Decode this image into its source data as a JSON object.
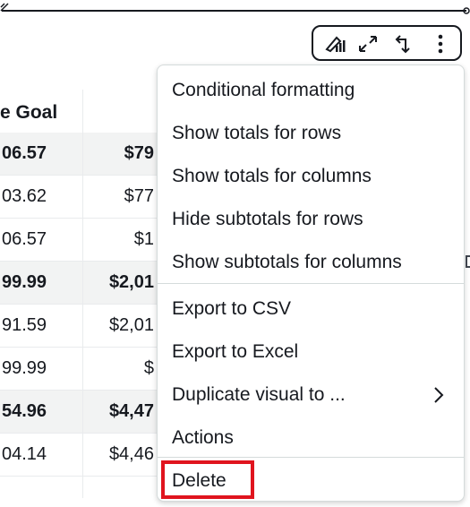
{
  "table": {
    "header_col1": "e Goal",
    "rows": [
      {
        "c1": "06.57",
        "c2": "$79",
        "bold": true
      },
      {
        "c1": "03.62",
        "c2": "$77",
        "bold": false
      },
      {
        "c1": "06.57",
        "c2": "$1",
        "bold": false
      },
      {
        "c1": "99.99",
        "c2": "$2,01",
        "bold": true
      },
      {
        "c1": "91.59",
        "c2": "$2,01",
        "bold": false
      },
      {
        "c1": "99.99",
        "c2": "$",
        "bold": false
      },
      {
        "c1": "54.96",
        "c2": "$4,47",
        "bold": true
      },
      {
        "c1": "04.14",
        "c2": "$4,46",
        "bold": false
      }
    ]
  },
  "menu": {
    "items": [
      "Conditional formatting",
      "Show totals for rows",
      "Show totals for columns",
      "Hide subtotals for rows",
      "Show subtotals for columns",
      "Export to CSV",
      "Export to Excel",
      "Duplicate visual to ...",
      "Actions",
      "Delete"
    ]
  },
  "toolbar": {
    "icons": [
      "format-visual-icon",
      "expand-icon",
      "drill-up-icon",
      "more-options-icon"
    ]
  },
  "colors": {
    "text": "#16191f",
    "highlight_border": "#e0141e",
    "divider": "#d5dbdb",
    "bold_row_bg": "#f2f3f3"
  }
}
